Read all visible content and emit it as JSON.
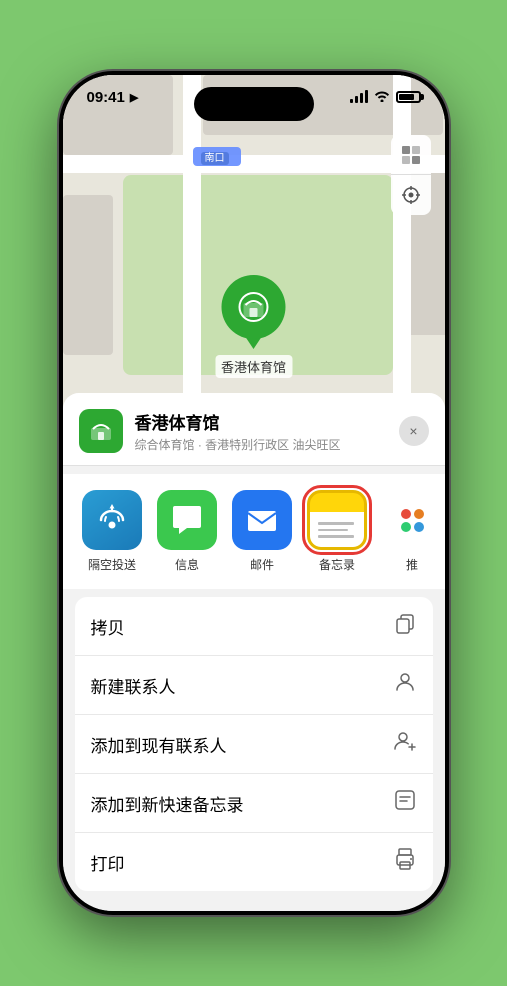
{
  "status": {
    "time": "09:41",
    "location_arrow": "▶"
  },
  "map": {
    "road_label": "南口",
    "pin_label": "香港体育馆"
  },
  "location_header": {
    "name": "香港体育馆",
    "desc": "综合体育馆 · 香港特别行政区 油尖旺区",
    "close_label": "×"
  },
  "share_apps": [
    {
      "id": "airdrop",
      "label": "隔空投送",
      "type": "airdrop"
    },
    {
      "id": "messages",
      "label": "信息",
      "type": "messages"
    },
    {
      "id": "mail",
      "label": "邮件",
      "type": "mail"
    },
    {
      "id": "notes",
      "label": "备忘录",
      "type": "notes",
      "selected": true
    },
    {
      "id": "more",
      "label": "推",
      "type": "more"
    }
  ],
  "action_items": [
    {
      "id": "copy",
      "label": "拷贝",
      "icon": "copy"
    },
    {
      "id": "new-contact",
      "label": "新建联系人",
      "icon": "person"
    },
    {
      "id": "add-contact",
      "label": "添加到现有联系人",
      "icon": "person-add"
    },
    {
      "id": "quick-note",
      "label": "添加到新快速备忘录",
      "icon": "note"
    },
    {
      "id": "print",
      "label": "打印",
      "icon": "print"
    }
  ]
}
